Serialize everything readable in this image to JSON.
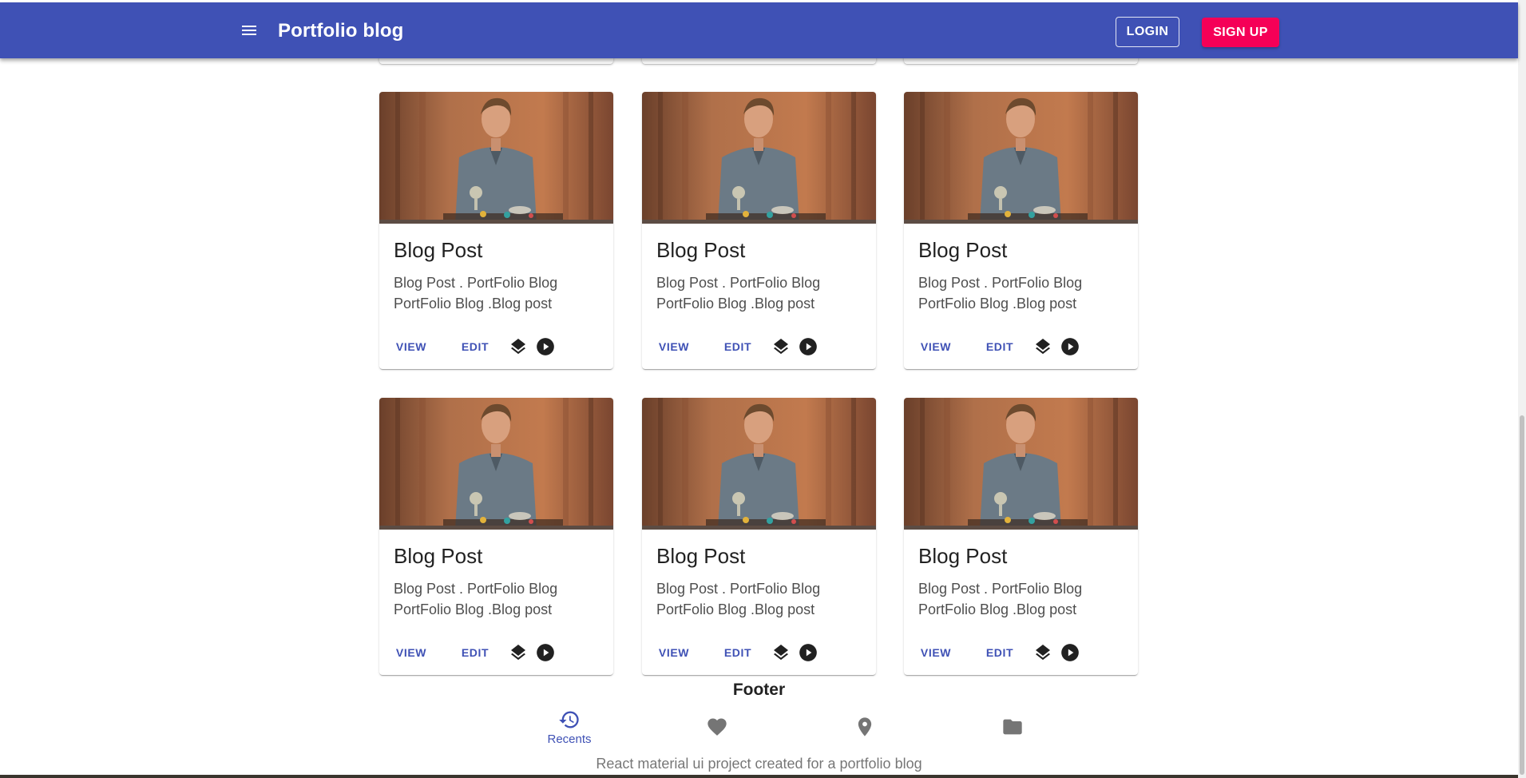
{
  "app_bar": {
    "title": "Portfolio blog",
    "login_label": "LOGIN",
    "signup_label": "SIGN UP",
    "menu_icon": "menu-icon"
  },
  "theme": {
    "primary": "#3f51b5",
    "secondary": "#f50057"
  },
  "cards": [
    {
      "title": "Blog Post",
      "line1": "Blog Post . PortFolio Blog",
      "line2": "PortFolio Blog .Blog post",
      "view_label": "VIEW",
      "edit_label": "EDIT"
    },
    {
      "title": "Blog Post",
      "line1": "Blog Post . PortFolio Blog",
      "line2": "PortFolio Blog .Blog post",
      "view_label": "VIEW",
      "edit_label": "EDIT"
    },
    {
      "title": "Blog Post",
      "line1": "Blog Post . PortFolio Blog",
      "line2": "PortFolio Blog .Blog post",
      "view_label": "VIEW",
      "edit_label": "EDIT"
    },
    {
      "title": "Blog Post",
      "line1": "Blog Post . PortFolio Blog",
      "line2": "PortFolio Blog .Blog post",
      "view_label": "VIEW",
      "edit_label": "EDIT"
    },
    {
      "title": "Blog Post",
      "line1": "Blog Post . PortFolio Blog",
      "line2": "PortFolio Blog .Blog post",
      "view_label": "VIEW",
      "edit_label": "EDIT"
    },
    {
      "title": "Blog Post",
      "line1": "Blog Post . PortFolio Blog",
      "line2": "PortFolio Blog .Blog post",
      "view_label": "VIEW",
      "edit_label": "EDIT"
    }
  ],
  "card_icons": [
    "layers-icon",
    "play-circle-icon"
  ],
  "footer": {
    "title": "Footer",
    "caption": "React material ui project created for a portfolio blog",
    "nav": [
      {
        "label": "Recents",
        "icon": "history-icon",
        "selected": true
      },
      {
        "label": "",
        "icon": "favorite-icon",
        "selected": false
      },
      {
        "label": "",
        "icon": "location-pin-icon",
        "selected": false
      },
      {
        "label": "",
        "icon": "folder-icon",
        "selected": false
      }
    ]
  }
}
